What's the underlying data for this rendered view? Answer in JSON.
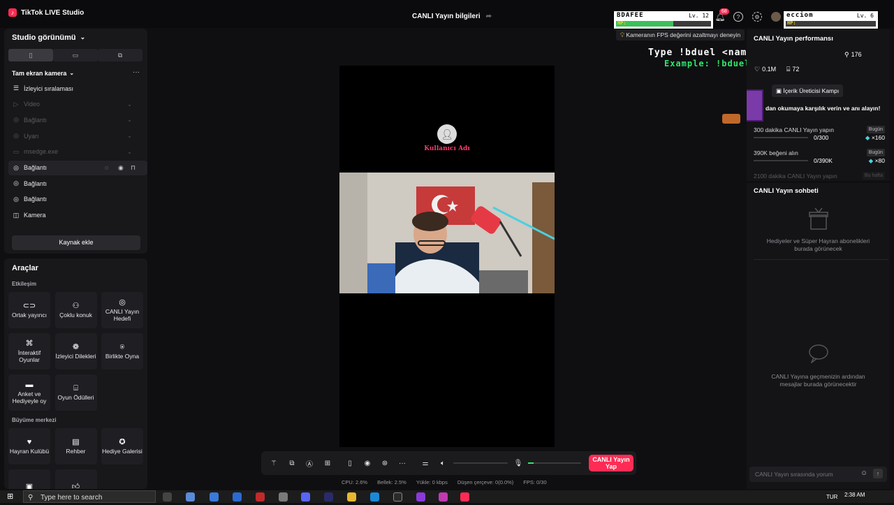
{
  "app": {
    "title": "TikTok LIVE Studio"
  },
  "header": {
    "stream_info": "CANLI Yayın bilgileri"
  },
  "overlay": {
    "player1": {
      "name": "BDAFEE",
      "level": "Lv. 12",
      "hp": "HP:",
      "hp_fraction": 0.6
    },
    "player2": {
      "name": "ecciom",
      "level": "Lv. 6",
      "hp": "HP:",
      "hp_fraction": 0.0
    },
    "command_text": "Type !bduel <name> to play",
    "example_text": "Example: !bduel ecciom",
    "fps_tip": "Kameranın FPS değerini azaltmayı deneyin"
  },
  "notifications": {
    "count": "68"
  },
  "left": {
    "studio_view": "Studio görünümü",
    "scene_title": "Tam ekran kamera",
    "sources": [
      {
        "label": "İzleyici sıralaması",
        "icon": "list-icon",
        "dim": false
      },
      {
        "label": "Video",
        "icon": "play-icon",
        "dim": true
      },
      {
        "label": "Bağlantı",
        "icon": "globe-icon",
        "dim": true
      },
      {
        "label": "Uyarı",
        "icon": "globe-icon",
        "dim": true
      },
      {
        "label": "msedge.exe",
        "icon": "window-icon",
        "dim": true
      },
      {
        "label": "Bağlantı",
        "icon": "globe-icon",
        "dim": false
      },
      {
        "label": "Bağlantı",
        "icon": "globe-icon",
        "dim": false
      },
      {
        "label": "Bağlantı",
        "icon": "globe-icon",
        "dim": false
      },
      {
        "label": "Kamera",
        "icon": "camera-icon",
        "dim": false
      }
    ],
    "add_source": "Kaynak ekle",
    "tools_title": "Araçlar",
    "engagement_label": "Etkileşim",
    "tools": [
      {
        "label": "Ortak yayıncı",
        "icon": "co-host-icon"
      },
      {
        "label": "Çoklu konuk",
        "icon": "multi-guest-icon"
      },
      {
        "label": "CANLI Yayın Hedefi",
        "icon": "live-goal-icon"
      },
      {
        "label": "İnteraktif Oyunlar",
        "icon": "gamepad-icon"
      },
      {
        "label": "İzleyici Dilekleri",
        "icon": "gift-icon"
      },
      {
        "label": "Birlikte Oyna",
        "icon": "play-together-icon"
      },
      {
        "label": "Anket ve Hediyeyle oy",
        "icon": "poll-icon"
      },
      {
        "label": "Oyun Ödülleri",
        "icon": "bag-icon"
      }
    ],
    "growth_label": "Büyüme merkezi",
    "growth_tools": [
      {
        "label": "Hayran Kulübü",
        "icon": "heart-icon"
      },
      {
        "label": "Rehber",
        "icon": "guide-icon"
      },
      {
        "label": "Hediye Galerisi",
        "icon": "gallery-icon"
      }
    ]
  },
  "canvas": {
    "username": "Kullanıcı Adı"
  },
  "toolbar": {
    "go_live": "CANLI Yayın Yap"
  },
  "stats": {
    "cpu": "CPU: 2.6%",
    "memory": "Bellek: 2.5%",
    "upload": "Yükle: 0 kbps",
    "dropped": "Düşen çerçeve: 0(0.0%)",
    "fps": "FPS: 0/30"
  },
  "perf": {
    "title": "CANLI Yayın performansı",
    "followers": "176",
    "likes": "0.1M",
    "gifts": "72",
    "campus_button": "İçerik Üreticisi Kampı",
    "campus_text": "dan okumaya karşılık verin ve anı alayın!",
    "quests": [
      {
        "title": "300 dakika CANLI Yayın yapın",
        "badge": "Bugün",
        "progress": "0/300",
        "reward": "×160",
        "fraction": 0
      },
      {
        "title": "390K beğeni alın",
        "badge": "Bugün",
        "progress": "0/390K",
        "reward": "×80",
        "fraction": 0
      },
      {
        "title": "2100 dakika CANLI Yayın yapın",
        "badge": "Bu hafta",
        "progress": "",
        "reward": "",
        "fraction": 0
      }
    ]
  },
  "chat": {
    "title": "CANLI Yayın sohbeti",
    "gifts_empty": "Hediyeler ve Süper Hayran abonelikleri burada görünecek",
    "messages_empty": "CANLI Yayına geçmenizin ardından mesajlar burada görünecektir",
    "input_placeholder": "CANLI Yayın sırasında yorum"
  },
  "taskbar": {
    "search_placeholder": "Type here to search",
    "language": "TUR",
    "time": "2:38 AM"
  }
}
